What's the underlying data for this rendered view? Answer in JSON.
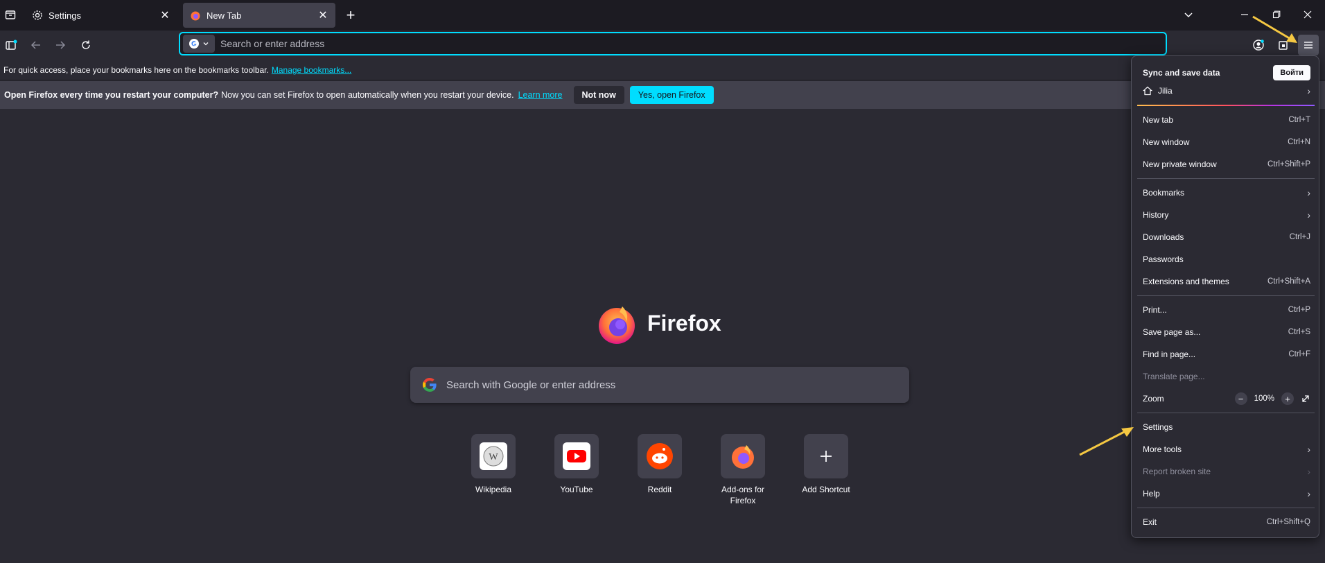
{
  "tabs": [
    {
      "label": "Settings",
      "icon": "gear-icon"
    },
    {
      "label": "New Tab",
      "icon": "firefox-icon"
    }
  ],
  "urlbar": {
    "placeholder": "Search or enter address"
  },
  "bookmarks_bar": {
    "text": "For quick access, place your bookmarks here on the bookmarks toolbar.",
    "link": "Manage bookmarks..."
  },
  "notification": {
    "bold": "Open Firefox every time you restart your computer?",
    "text": "Now you can set Firefox to open automatically when you restart your device.",
    "link": "Learn more",
    "not_now": "Not now",
    "yes": "Yes, open Firefox"
  },
  "newtab": {
    "brand": "Firefox",
    "search_placeholder": "Search with Google or enter address",
    "shortcuts": [
      {
        "label": "Wikipedia"
      },
      {
        "label": "YouTube"
      },
      {
        "label": "Reddit"
      },
      {
        "label": "Add-ons for Firefox"
      },
      {
        "label": "Add Shortcut"
      }
    ]
  },
  "menu": {
    "sync_title": "Sync and save data",
    "signin": "Войти",
    "profile": "Jilia",
    "items": [
      {
        "label": "New tab",
        "key": "Ctrl+T"
      },
      {
        "label": "New window",
        "key": "Ctrl+N"
      },
      {
        "label": "New private window",
        "key": "Ctrl+Shift+P"
      },
      {
        "label": "Bookmarks",
        "key": ""
      },
      {
        "label": "History",
        "key": ""
      },
      {
        "label": "Downloads",
        "key": "Ctrl+J"
      },
      {
        "label": "Passwords",
        "key": ""
      },
      {
        "label": "Extensions and themes",
        "key": "Ctrl+Shift+A"
      },
      {
        "label": "Print...",
        "key": "Ctrl+P"
      },
      {
        "label": "Save page as...",
        "key": "Ctrl+S"
      },
      {
        "label": "Find in page...",
        "key": "Ctrl+F"
      },
      {
        "label": "Translate page...",
        "key": ""
      },
      {
        "label": "Zoom",
        "key": ""
      },
      {
        "label": "Settings",
        "key": ""
      },
      {
        "label": "More tools",
        "key": ""
      },
      {
        "label": "Report broken site",
        "key": ""
      },
      {
        "label": "Help",
        "key": ""
      },
      {
        "label": "Exit",
        "key": "Ctrl+Shift+Q"
      }
    ],
    "zoom_value": "100%"
  },
  "colors": {
    "accent": "#00ddff",
    "annotation_arrow": "#f5c842"
  }
}
